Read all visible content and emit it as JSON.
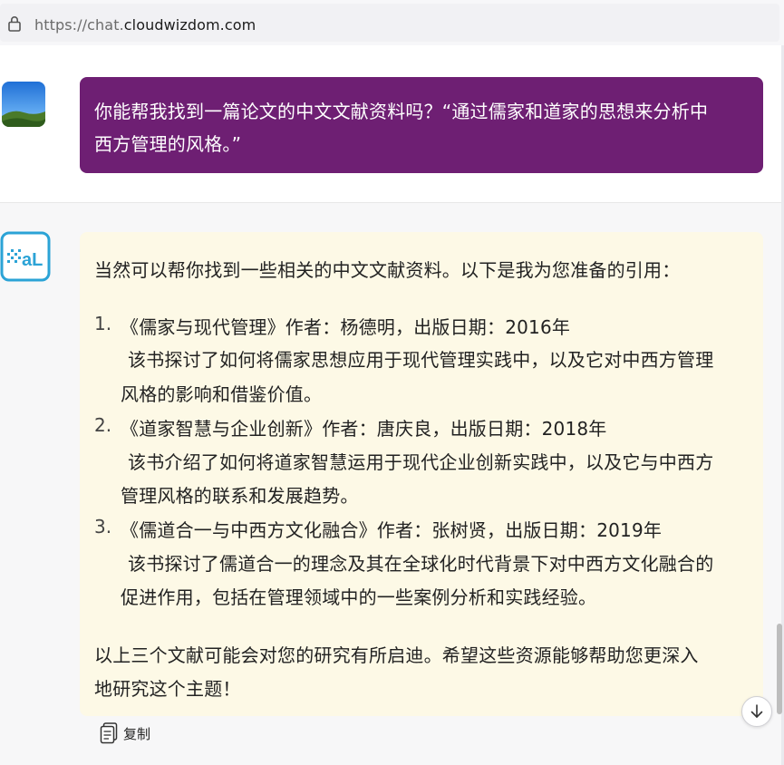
{
  "browser": {
    "url_scheme": "https://chat.",
    "url_host": "cloudwizdom.com"
  },
  "user_message": {
    "line1": "你能帮我找到一篇论文的中文文献资料吗？“通过儒家和道家的思想来分析中",
    "line2": "西方管理的风格。”"
  },
  "assistant_message": {
    "intro": "当然可以帮你找到一些相关的中文文献资料。以下是我为您准备的引用：",
    "items": [
      {
        "num": "1.",
        "title": "《儒家与现代管理》作者：杨德明，出版日期：2016年",
        "desc1": "该书探讨了如何将儒家思想应用于现代管理实践中，以及它对中西方管理",
        "desc2": "风格的影响和借鉴价值。"
      },
      {
        "num": "2.",
        "title": "《道家智慧与企业创新》作者：唐庆良，出版日期：2018年",
        "desc1": "该书介绍了如何将道家智慧运用于现代企业创新实践中，以及它与中西方",
        "desc2": "管理风格的联系和发展趋势。"
      },
      {
        "num": "3.",
        "title": "《儒道合一与中西方文化融合》作者：张树贤，出版日期：2019年",
        "desc1": "该书探讨了儒道合一的理念及其在全球化时代背景下对中西方文化融合的",
        "desc2": "促进作用，包括在管理领域中的一些案例分析和实践经验。"
      }
    ],
    "outro1": "以上三个文献可能会对您的研究有所启迪。希望这些资源能够帮助您更深入",
    "outro2": "地研究这个主题！"
  },
  "actions": {
    "copy_label": "复制"
  },
  "colors": {
    "user_bubble": "#6e1f73",
    "assistant_bubble": "#fdf9e6",
    "ai_logo": "#2ba3d6"
  },
  "icons": {
    "lock": "lock-icon",
    "copy": "copy-icon",
    "scroll_down": "arrow-down-icon"
  }
}
